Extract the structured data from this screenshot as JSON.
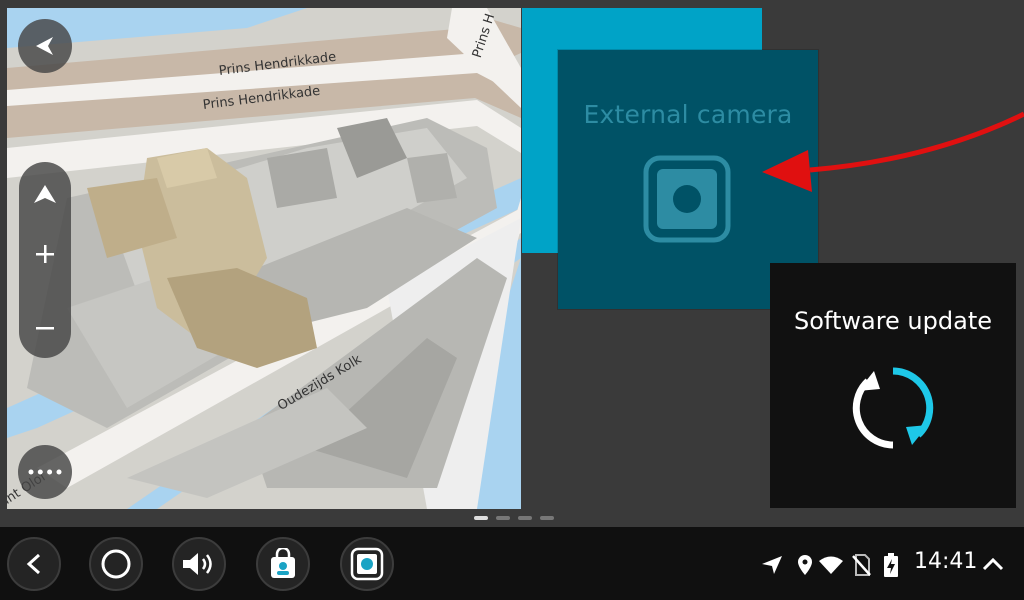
{
  "map": {
    "streets": [
      "Prins Hendrikkade",
      "Prins Hendrikkade",
      "Prins H",
      "Oudezijds Kolk",
      "int Olof"
    ]
  },
  "tiles": {
    "camera": {
      "title": "External camera",
      "icon": "camera-icon"
    },
    "update": {
      "title": "Software update",
      "icon": "sync-icon"
    }
  },
  "pager": {
    "count": 4,
    "active": 0
  },
  "navbar": {
    "buttons": [
      "back-icon",
      "home-icon",
      "volume-icon",
      "store-icon",
      "camera-app-icon"
    ],
    "status_icons": [
      "location-arrow-icon",
      "map-pin-icon",
      "wifi-icon",
      "no-sim-icon",
      "battery-charging-icon",
      "chevron-up-icon"
    ],
    "time": "14:41"
  },
  "colors": {
    "accent_blue": "#00a3c7",
    "camera_tile": "#005266",
    "annotation": "#e01010"
  }
}
